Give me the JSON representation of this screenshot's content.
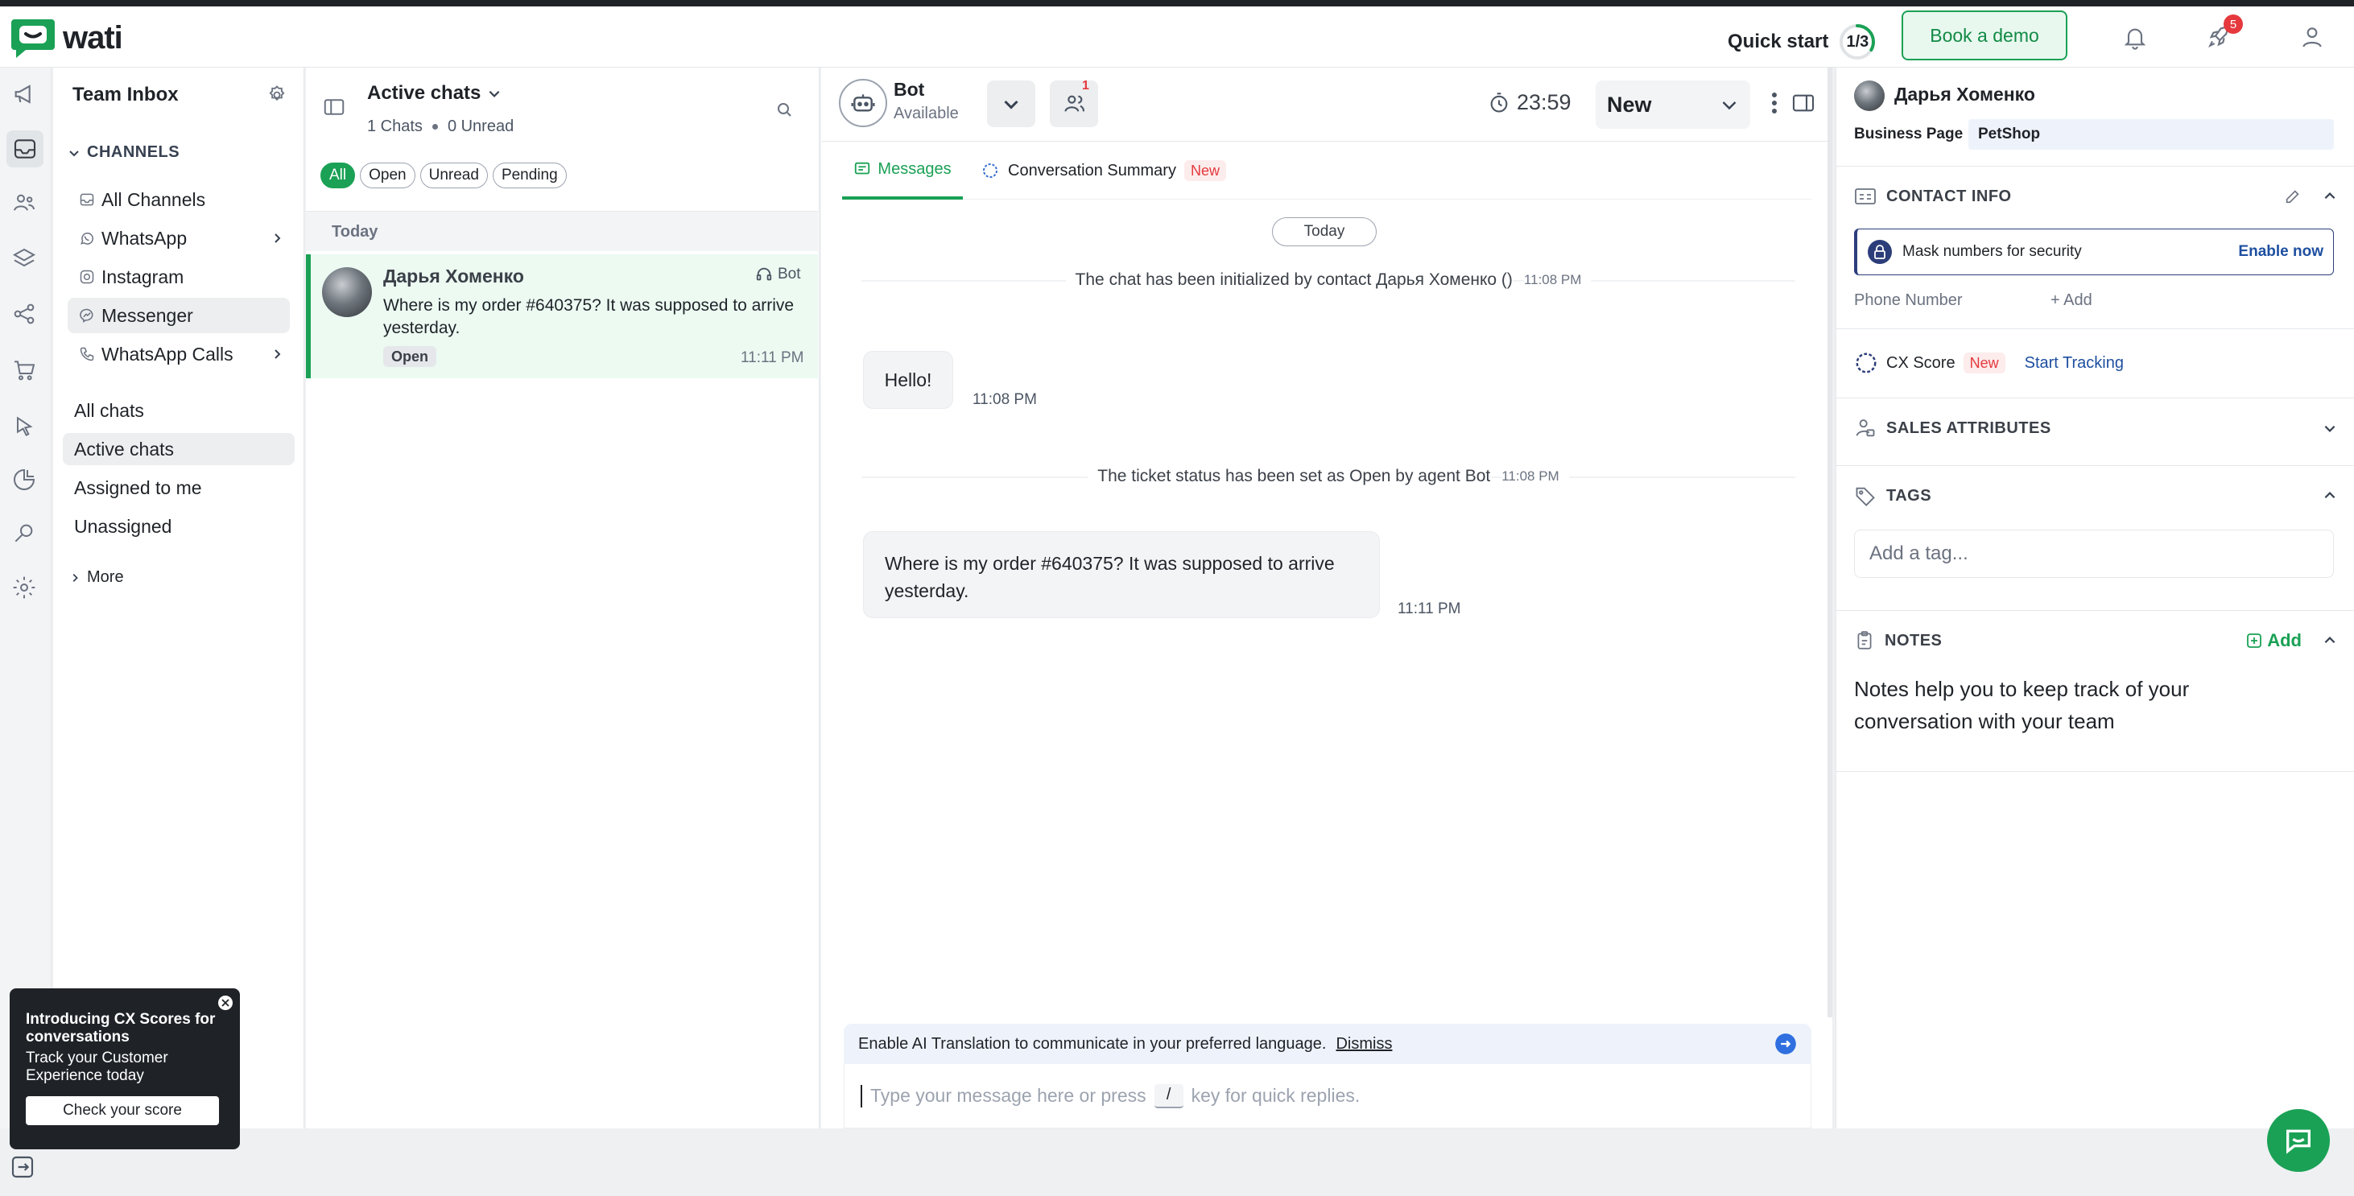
{
  "app": {
    "logo": "wati"
  },
  "topbar": {
    "quick_start": "Quick start",
    "progress": "1/3",
    "progress_fraction": 0.333,
    "book_demo": "Book a demo",
    "rocket_badge": "5"
  },
  "inbox_nav": {
    "title": "Team Inbox",
    "channels_heading": "CHANNELS",
    "channels": [
      {
        "label": "All Channels",
        "icon": "inbox-icon",
        "arrow": false
      },
      {
        "label": "WhatsApp",
        "icon": "whatsapp-icon",
        "arrow": true
      },
      {
        "label": "Instagram",
        "icon": "instagram-icon",
        "arrow": false
      },
      {
        "label": "Messenger",
        "icon": "messenger-icon",
        "arrow": false,
        "selected": true
      },
      {
        "label": "WhatsApp Calls",
        "icon": "phone-icon",
        "arrow": true
      }
    ],
    "views": [
      "All chats",
      "Active chats",
      "Assigned to me",
      "Unassigned"
    ],
    "active_view": "Active chats",
    "more": "More"
  },
  "chatlist": {
    "title": "Active chats",
    "chats_count": "1 Chats",
    "unread_count": "0 Unread",
    "filters": [
      "All",
      "Open",
      "Unread",
      "Pending"
    ],
    "active_filter": "All",
    "section": "Today",
    "items": [
      {
        "name": "Дарья Хоменко",
        "agent": "Bot",
        "preview": "Where is my order #640375? It was supposed to arrive yesterday.",
        "status": "Open",
        "time": "11:11 PM"
      }
    ]
  },
  "conversation": {
    "agent_name": "Bot",
    "agent_status": "Available",
    "participants_badge": "1",
    "timer": "23:59",
    "status_select": "New",
    "tabs": {
      "messages": "Messages",
      "summary": "Conversation Summary",
      "summary_badge": "New"
    },
    "date_divider": "Today",
    "system1": {
      "text": "The chat has been initialized by contact Дарья Хоменко ()",
      "time": "11:08 PM"
    },
    "msg1": {
      "text": "Hello!",
      "time": "11:08 PM"
    },
    "system2": {
      "text": "The ticket status has been set as Open by agent Bot",
      "time": "11:08 PM"
    },
    "msg2": {
      "text": "Where is my order #640375? It was supposed to arrive yesterday.",
      "time": "11:11 PM"
    },
    "translation_banner": "Enable AI Translation to communicate in your preferred language.",
    "dismiss": "Dismiss",
    "composer": {
      "before": "Type your message here or press",
      "key": "/",
      "after": "key for quick replies."
    }
  },
  "contact": {
    "name": "Дарья Хоменко",
    "business_label": "Business Page",
    "business_value": "PetShop",
    "contact_info": "CONTACT INFO",
    "mask_text": "Mask numbers for security",
    "enable_now": "Enable now",
    "phone_label": "Phone Number",
    "add_phone": "+ Add",
    "cx_label": "CX Score",
    "cx_badge": "New",
    "start_tracking": "Start Tracking",
    "sales_attributes": "SALES ATTRIBUTES",
    "tags_label": "TAGS",
    "tag_placeholder": "Add a tag...",
    "notes_label": "NOTES",
    "notes_add": "Add",
    "notes_help": "Notes help you to keep track of your conversation with your team"
  },
  "promo": {
    "title": "Introducing CX Scores for conversations",
    "body": "Track your Customer Experience today",
    "button": "Check your score"
  },
  "colors": {
    "brand": "#1aa155",
    "selected_chat": "#ecfaf2",
    "badge_red": "#e5393d",
    "link_blue": "#1e4fa0"
  }
}
